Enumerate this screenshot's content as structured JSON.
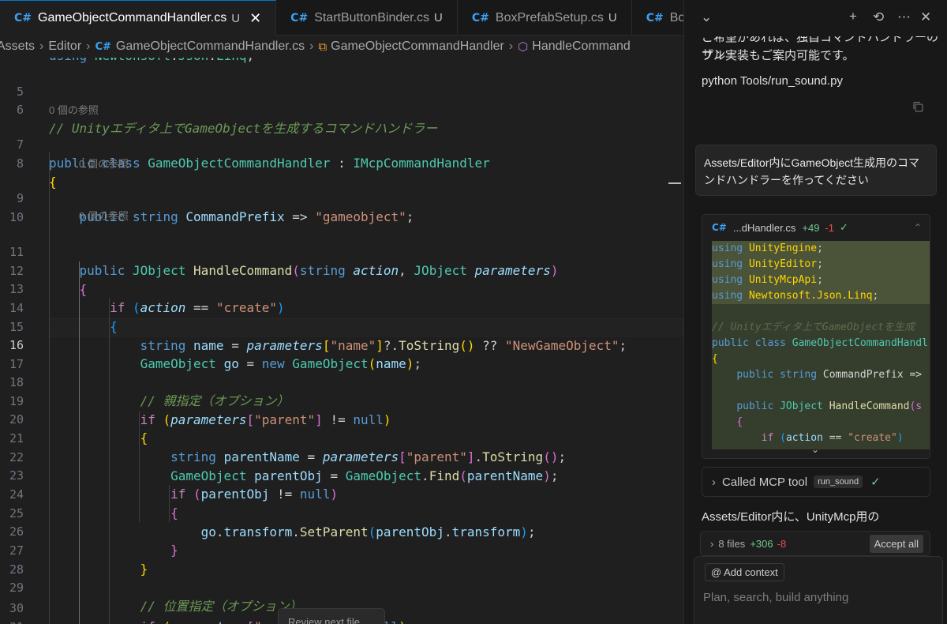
{
  "tabs": [
    {
      "label": "GameObjectCommandHandler.cs",
      "modified": "U",
      "close": "✕"
    },
    {
      "label": "StartButtonBinder.cs",
      "modified": "U"
    },
    {
      "label": "BoxPrefabSetup.cs",
      "modified": "U"
    },
    {
      "label": "BoxS"
    }
  ],
  "breadcrumb": [
    "Assets",
    "Editor",
    "GameObjectCommandHandler.cs",
    "GameObjectCommandHandler",
    "HandleCommand"
  ],
  "editor": {
    "partial_top_line": "using Newtonsoft.Json.Linq;",
    "line_numbers": [
      "5",
      "6",
      "7",
      "8",
      "9",
      "10",
      "11",
      "12",
      "13",
      "14",
      "15",
      "16",
      "17",
      "18",
      "19",
      "20",
      "21",
      "22",
      "23",
      "24",
      "25",
      "26",
      "27",
      "28",
      "29",
      "30",
      "31"
    ],
    "current_line": "16",
    "reference_hint": "0 個の参照",
    "review_button": "Review next file"
  },
  "panel": {
    "top_message_line1": "ご希望があれば、独自コマンドハンドラーのサン",
    "top_message_line2": "プル実装もご案内可能です。",
    "command_text": "python Tools/run_sound.py",
    "user_message": "Assets/Editor内にGameObject生成用のコマンドハンドラーを作ってください",
    "diff": {
      "filename": "...dHandler.cs",
      "added": "+49",
      "removed": "-1",
      "check": "✓",
      "lines": [
        "using UnityEngine;",
        "using UnityEditor;",
        "using UnityMcpApi;",
        "using Newtonsoft.Json.Linq;",
        "",
        "// Unityエディタ上でGameObjectを生成",
        "public class GameObjectCommandHandl",
        "{",
        "    public string CommandPrefix =>",
        "",
        "    public JObject HandleCommand(s",
        "    {",
        "        if (action == \"create\")",
        "        {"
      ]
    },
    "tool_call": {
      "label": "Called MCP tool",
      "tag": "run_sound",
      "check": "✓"
    },
    "response_text": "Assets/Editor内に、UnityMcp用の",
    "files": {
      "count": "8 files",
      "added": "+306",
      "removed": "-8",
      "accept": "Accept all"
    },
    "composer": {
      "add_context": "Add context",
      "placeholder": "Plan, search, build anything"
    }
  }
}
